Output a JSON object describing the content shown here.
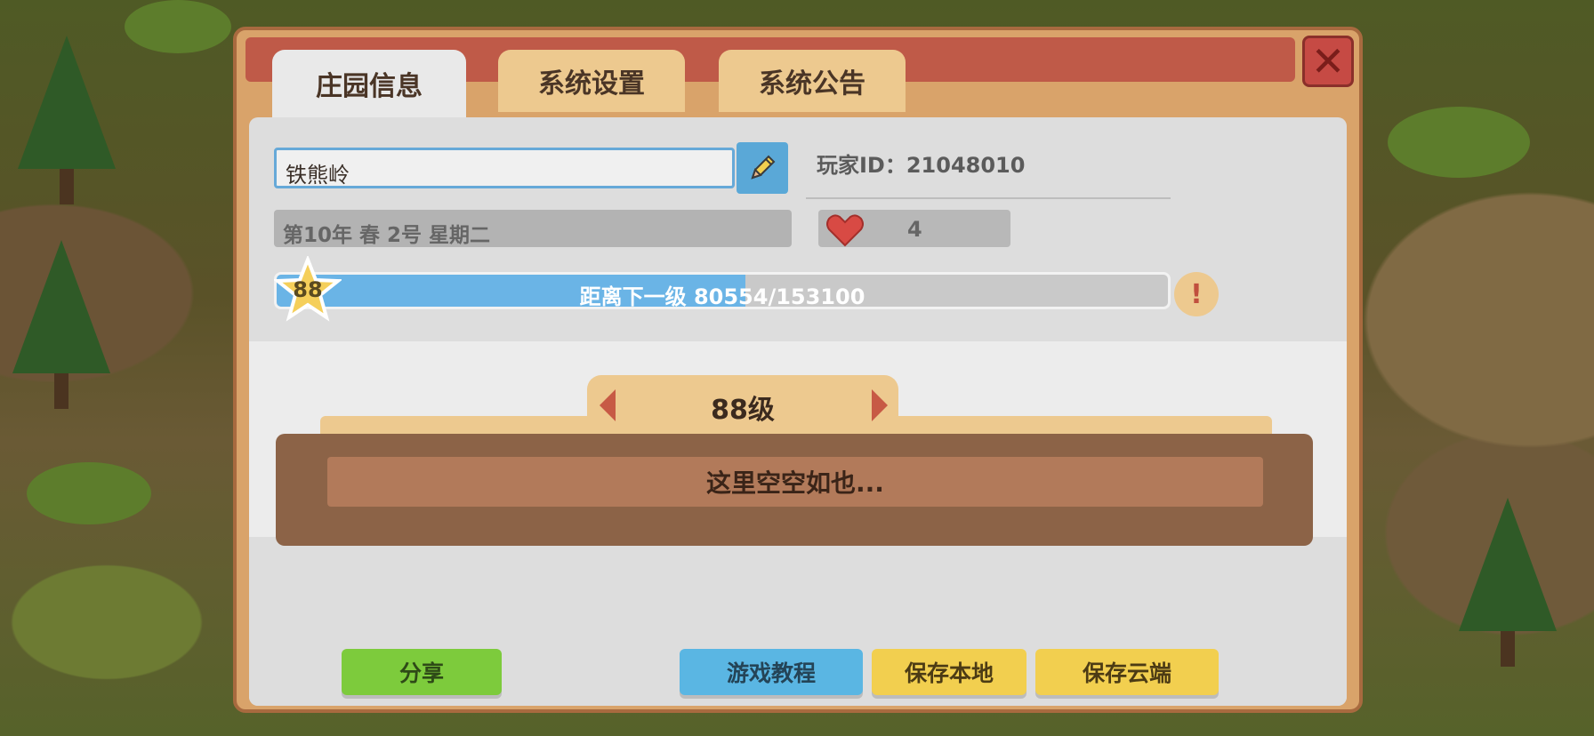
{
  "tabs": [
    {
      "label": "庄园信息",
      "active": true
    },
    {
      "label": "系统设置",
      "active": false
    },
    {
      "label": "系统公告",
      "active": false
    }
  ],
  "close_icon": "close-icon",
  "farm": {
    "name": "铁熊岭",
    "player_id_label": "玩家ID：21048010",
    "date": "第10年  春  2号 星期二",
    "hearts": "4"
  },
  "level": {
    "current": "88",
    "progress_text": "距离下一级   80554/153100",
    "progress_current": 80554,
    "progress_total": 153100,
    "selector_label": "88级",
    "empty_text": "这里空空如也..."
  },
  "buttons": {
    "share": "分享",
    "tutorial": "游戏教程",
    "save_local": "保存本地",
    "save_cloud": "保存云端"
  },
  "colors": {
    "accent_blue": "#6ab4e6",
    "heart_red": "#d84a44",
    "tab_active": "#e9e9e9",
    "tab_inactive": "#edc98f"
  }
}
